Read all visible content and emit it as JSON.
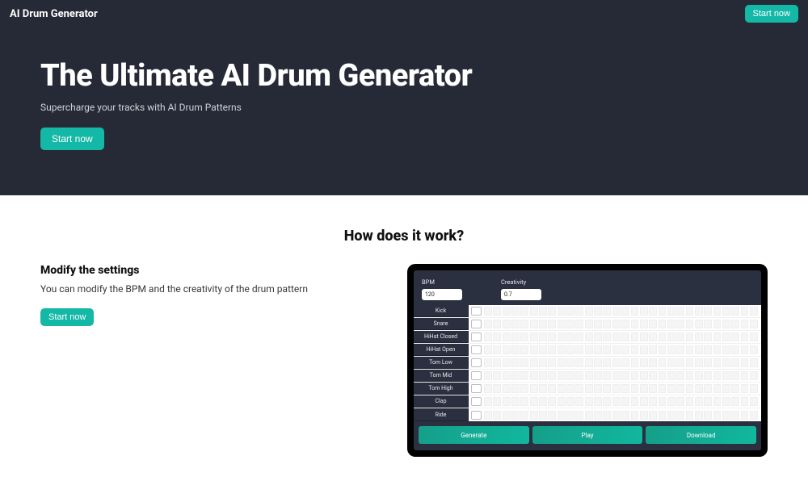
{
  "brand": "AI Drum Generator",
  "cta": {
    "top": "Start now",
    "hero": "Start now",
    "section": "Start now"
  },
  "hero": {
    "title": "The Ultimate AI Drum Generator",
    "subtitle": "Supercharge your tracks with AI Drum Patterns"
  },
  "section": {
    "heading": "How does it work?",
    "sub_heading": "Modify the settings",
    "desc": "You can modify the BPM and the creativity of the drum pattern"
  },
  "preview": {
    "bpm_label": "BPM",
    "bpm_value": "120",
    "creativity_label": "Creativity",
    "creativity_value": "0.7",
    "tracks": [
      "Kick",
      "Snare",
      "HiHat Closed",
      "HiHat Open",
      "Tom Low",
      "Tom Mid",
      "Tom High",
      "Clap",
      "Ride"
    ],
    "buttons": {
      "generate": "Generate",
      "play": "Play",
      "download": "Download"
    }
  },
  "colors": {
    "accent": "#14b8a6",
    "hero_bg": "#262a36"
  }
}
